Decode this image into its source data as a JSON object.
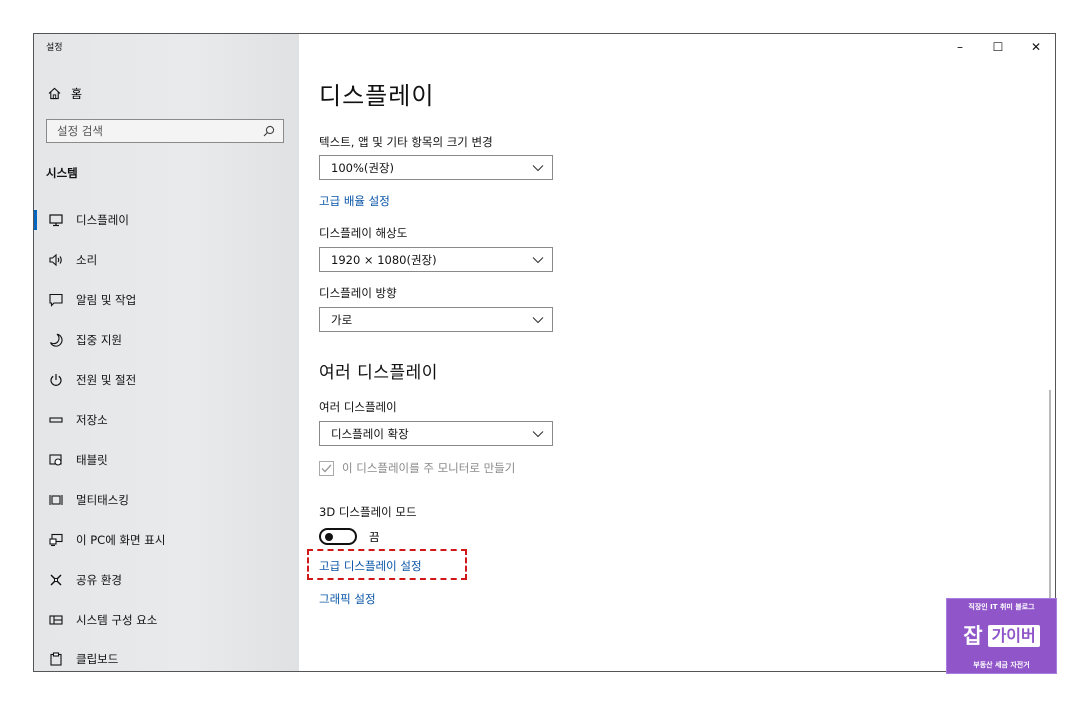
{
  "window": {
    "title": "설정",
    "controls": {
      "minimize": "–",
      "maximize": "☐",
      "close": "✕"
    }
  },
  "sidebar": {
    "home_label": "홈",
    "search_placeholder": "설정 검색",
    "section_title": "시스템",
    "items": [
      {
        "label": "디스플레이",
        "icon": "monitor-icon",
        "active": true
      },
      {
        "label": "소리",
        "icon": "speaker-icon"
      },
      {
        "label": "알림 및 작업",
        "icon": "notification-icon"
      },
      {
        "label": "집중 지원",
        "icon": "moon-icon"
      },
      {
        "label": "전원 및 절전",
        "icon": "power-icon"
      },
      {
        "label": "저장소",
        "icon": "storage-icon"
      },
      {
        "label": "태블릿",
        "icon": "tablet-icon"
      },
      {
        "label": "멀티태스킹",
        "icon": "multitasking-icon"
      },
      {
        "label": "이 PC에 화면 표시",
        "icon": "project-icon"
      },
      {
        "label": "공유 환경",
        "icon": "share-icon"
      },
      {
        "label": "시스템 구성 요소",
        "icon": "components-icon"
      },
      {
        "label": "클립보드",
        "icon": "clipboard-icon"
      }
    ]
  },
  "main": {
    "page_title": "디스플레이",
    "scale_label": "텍스트, 앱 및 기타 항목의 크기 변경",
    "scale_value": "100%(권장)",
    "advanced_scaling_link": "고급 배율 설정",
    "resolution_label": "디스플레이 해상도",
    "resolution_value": "1920 × 1080(권장)",
    "orientation_label": "디스플레이 방향",
    "orientation_value": "가로",
    "multi_title": "여러 디스플레이",
    "multi_label": "여러 디스플레이",
    "multi_value": "디스플레이 확장",
    "main_display_checkbox": "이 디스플레이를 주 모니터로 만들기",
    "mode_3d_label": "3D 디스플레이 모드",
    "mode_3d_state": "끔",
    "advanced_display_link": "고급 디스플레이 설정",
    "graphics_link": "그래픽 설정"
  },
  "watermark": {
    "top": "직장인 IT 취미 블로그",
    "initial": "잡",
    "name": "가이버",
    "bottom": "부동산 세금 자전거"
  },
  "colors": {
    "accent": "#0067c0",
    "link": "#0a56a8",
    "highlight": "#d01818",
    "watermark": "#8f55c9"
  }
}
